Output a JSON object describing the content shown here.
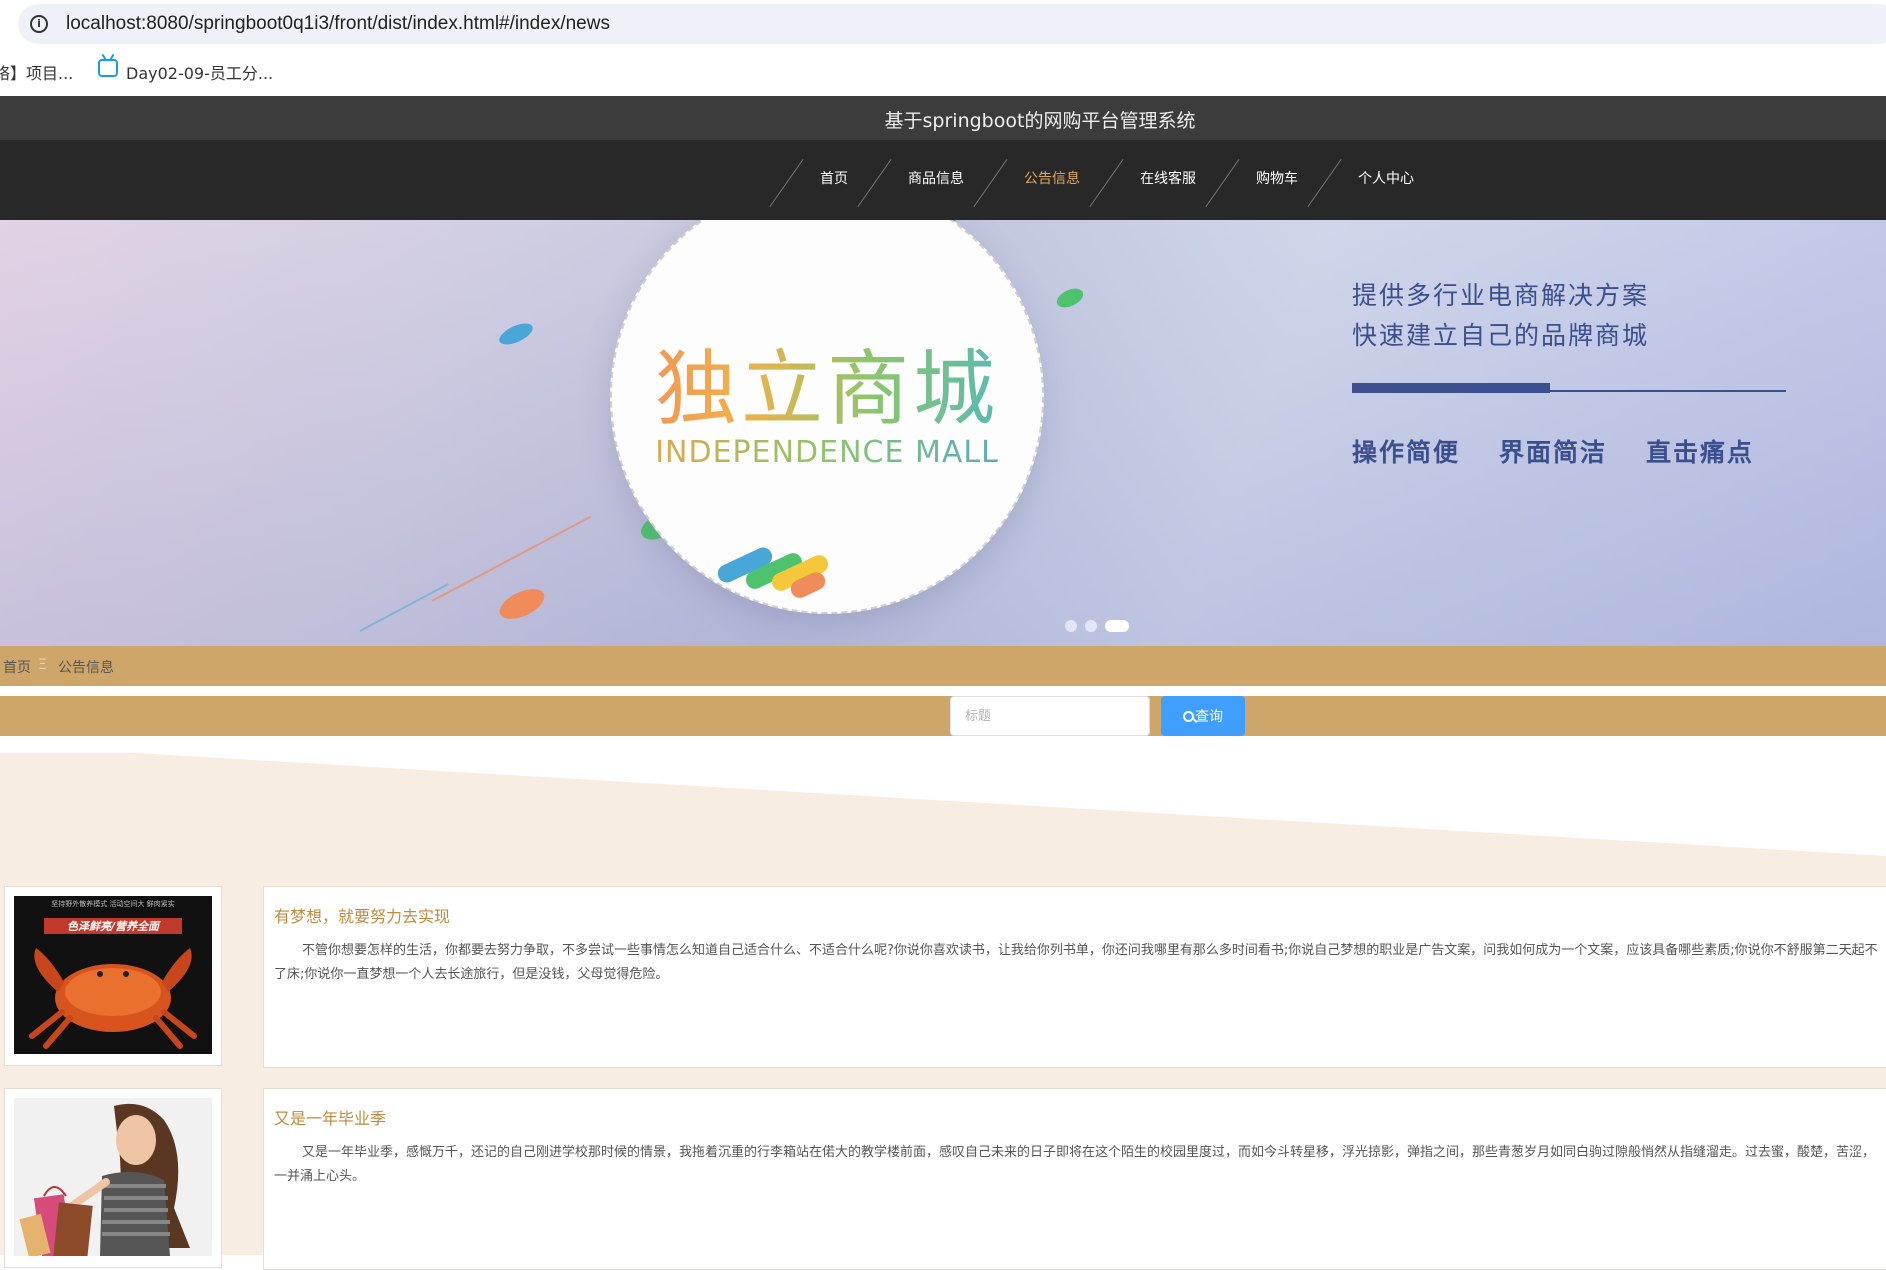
{
  "browser": {
    "url": "localhost:8080/springboot0q1i3/front/dist/index.html#/index/news",
    "bookmarks": [
      {
        "label": "络】项目..."
      },
      {
        "label": "Day02-09-员工分..."
      }
    ]
  },
  "site": {
    "title": "基于springboot的网购平台管理系统"
  },
  "nav": {
    "items": [
      {
        "label": "首页"
      },
      {
        "label": "商品信息"
      },
      {
        "label": "公告信息"
      },
      {
        "label": "在线客服"
      },
      {
        "label": "购物车"
      },
      {
        "label": "个人中心"
      }
    ],
    "active": "公告信息",
    "active_color": "#e0a960"
  },
  "banner": {
    "logo_cn": "独立商城",
    "logo_en": "INDEPENDENCE MALL",
    "slogan_line1": "提供多行业电商解决方案",
    "slogan_line2": "快速建立自己的品牌商城",
    "features": [
      "操作简便",
      "界面简洁",
      "直击痛点"
    ],
    "carousel_total": 3,
    "carousel_active": 3
  },
  "breadcrumb": {
    "home": "首页",
    "separator": "Ξ",
    "current": "公告信息"
  },
  "search": {
    "placeholder": "标题",
    "value": "",
    "button_label": "查询"
  },
  "news": [
    {
      "title": "有梦想，就要努力去实现",
      "description": "不管你想要怎样的生活，你都要去努力争取，不多尝试一些事情怎么知道自己适合什么、不适合什么呢?你说你喜欢读书，让我给你列书单，你还问我哪里有那么多时间看书;你说自己梦想的职业是广告文案，问我如何成为一个文案，应该具备哪些素质;你说你不舒服第二天起不了床;你说你一直梦想一个人去长途旅行，但是没钱，父母觉得危险。",
      "image_caption": "色泽鲜亮/营养全面",
      "image_top_text": "坚持野外散养模式 活动空间大 鲜肉紧实"
    },
    {
      "title": "又是一年毕业季",
      "description": "又是一年毕业季，感慨万千，还记的自己刚进学校那时候的情景，我拖着沉重的行李箱站在偌大的教学楼前面，感叹自己未来的日子即将在这个陌生的校园里度过，而如今斗转星移，浮光掠影，弹指之间，那些青葱岁月如同白驹过隙般悄然从指缝溜走。过去蜜，酸楚，苦涩，一并涌上心头。"
    }
  ],
  "colors": {
    "band": "#cfa66a",
    "search_button": "#409eff",
    "news_title": "#c08a3e",
    "content_bg": "#f8ede3"
  }
}
